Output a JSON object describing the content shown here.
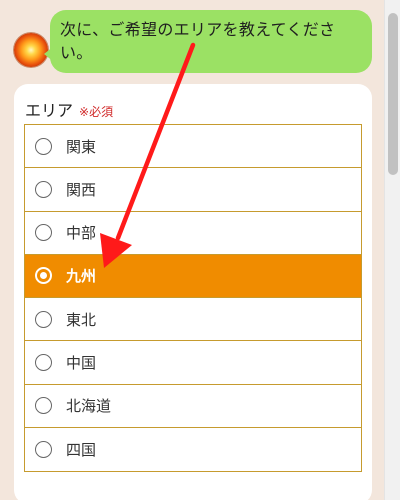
{
  "chat": {
    "message": "次に、ご希望のエリアを教えてください。"
  },
  "form": {
    "label": "エリア",
    "required": "※必須",
    "selected": "九州",
    "options": [
      {
        "label": "関東"
      },
      {
        "label": "関西"
      },
      {
        "label": "中部"
      },
      {
        "label": "九州"
      },
      {
        "label": "東北"
      },
      {
        "label": "中国"
      },
      {
        "label": "北海道"
      },
      {
        "label": "四国"
      }
    ]
  },
  "colors": {
    "bubble": "#9be164",
    "selected": "#f08c00",
    "border": "#c69b2e",
    "required": "#d12a2a",
    "arrow": "#ff1a1a"
  },
  "annotation": {
    "arrow_icon": "red-arrow-icon"
  }
}
